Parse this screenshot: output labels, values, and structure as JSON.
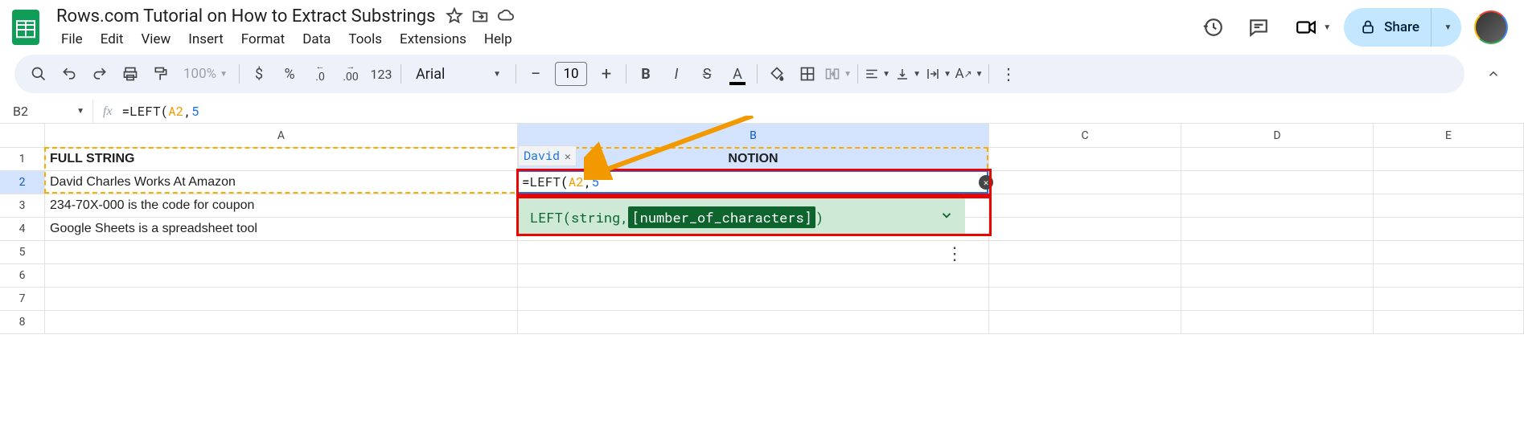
{
  "doc": {
    "title": "Rows.com Tutorial on How to Extract Substrings"
  },
  "menus": [
    "File",
    "Edit",
    "View",
    "Insert",
    "Format",
    "Data",
    "Tools",
    "Extensions",
    "Help"
  ],
  "header_right": {
    "share_label": "Share"
  },
  "toolbar": {
    "zoom": "100%",
    "currency": "$",
    "percent": "%",
    "dec_dec": ".0",
    "inc_dec": ".00",
    "num_format": "123",
    "font_name": "Arial",
    "font_size": "10",
    "bold": "B",
    "italic": "I",
    "strike": "S",
    "text_color": "A"
  },
  "name_box": "B2",
  "formula_bar": {
    "eq": "=",
    "fn": "LEFT",
    "open": "(",
    "ref": "A2",
    "comma": ",",
    "num": "5"
  },
  "columns": [
    "A",
    "B",
    "C",
    "D",
    "E"
  ],
  "row_numbers": [
    "1",
    "2",
    "3",
    "4",
    "5",
    "6",
    "7",
    "8"
  ],
  "cells": {
    "a1": "FULL STRING",
    "b1": "NOTION",
    "a2": "David Charles Works At Amazon",
    "a3": "234-70X-000 is the code for coupon",
    "a4": "Google Sheets is a spreadsheet tool"
  },
  "preview_value": "David",
  "edit_formula": {
    "eq": "=",
    "fn": "LEFT",
    "open": "(",
    "ref": "A2",
    "comma": ",",
    "num": "5"
  },
  "formula_help": {
    "fn": "LEFT",
    "open": "(",
    "p1": "string",
    "comma": ", ",
    "p2": "[number_of_characters]",
    "close": ")"
  }
}
